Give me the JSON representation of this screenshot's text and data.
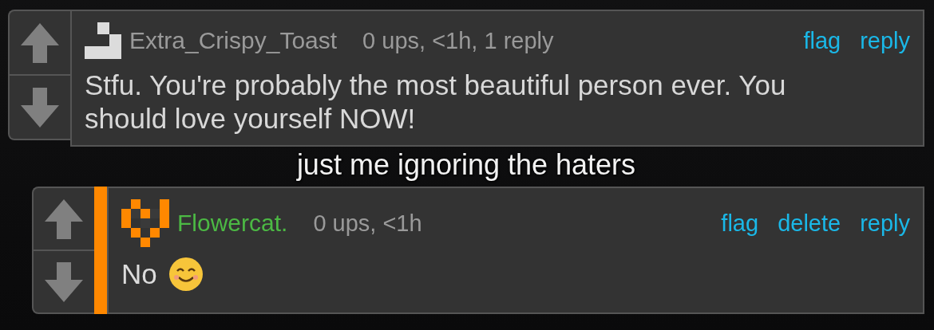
{
  "comments": [
    {
      "kind": "comment",
      "author": "Extra_Crispy_Toast",
      "color": "#9a9a9a",
      "meta": "0 ups, <1h, 1 reply",
      "actions": [
        "flag",
        "reply"
      ],
      "body": "Stfu. You're probably the most beautiful person ever. You should love yourself NOW!"
    },
    {
      "kind": "reply",
      "author": "Flowercat.",
      "color": "#4cb944",
      "meta": "0 ups, <1h",
      "actions": [
        "flag",
        "delete",
        "reply"
      ],
      "body": "No"
    }
  ],
  "caption": "just me ignoring the haters"
}
